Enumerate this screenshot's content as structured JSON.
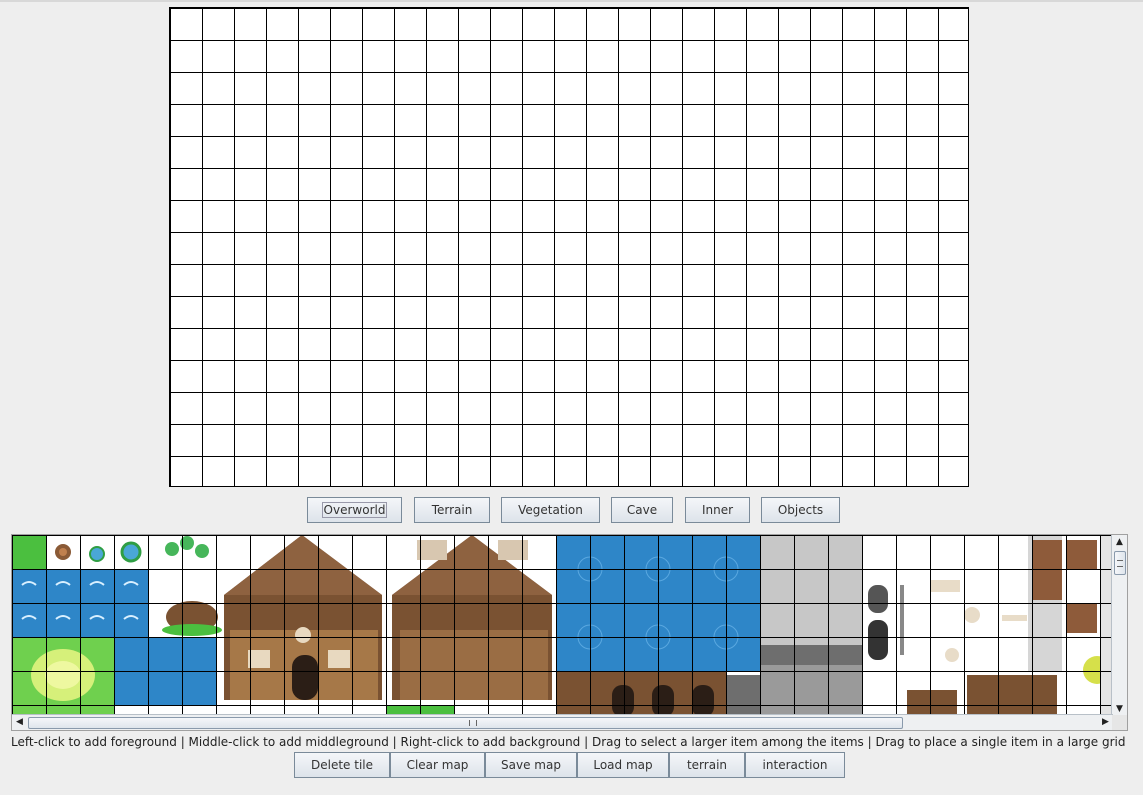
{
  "category_tabs": [
    "Overworld",
    "Terrain",
    "Vegetation",
    "Cave",
    "Inner",
    "Objects"
  ],
  "selected_category": "Overworld",
  "instructions": "Left-click to add foreground  |  Middle-click to add middleground  |  Right-click to add background  |  Drag to select a larger item among the items  |  Drag to place a single item in a large grid",
  "actions": {
    "delete_tile": "Delete tile",
    "clear_map": "Clear map",
    "save_map": "Save map",
    "load_map": "Load map",
    "terrain": "terrain",
    "interaction": "interaction"
  },
  "icons": {
    "scroll_left": "arrow-left-icon",
    "scroll_right": "arrow-right-icon",
    "scroll_up": "arrow-up-icon",
    "scroll_down": "arrow-down-icon"
  },
  "colors": {
    "grass": "#4bbf3f",
    "water": "#2e86c8",
    "wood": "#7a5232",
    "stone": "#c7c7c7",
    "dark_stone": "#6e6e6e"
  }
}
